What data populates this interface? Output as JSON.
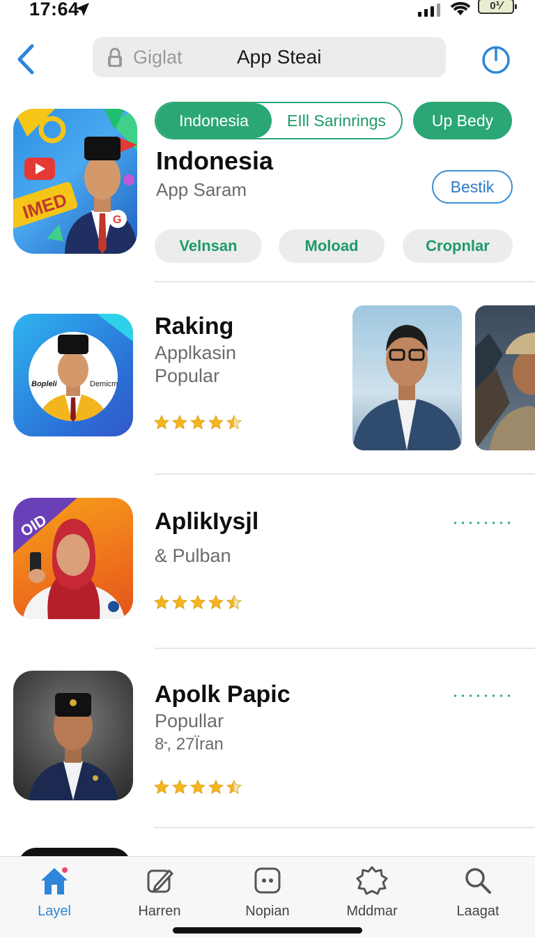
{
  "status_bar": {
    "time": "17:64",
    "battery_text": "0⅟"
  },
  "nav": {
    "search_placeholder": "Giglat",
    "title": "App Steai"
  },
  "featured": {
    "segment_left": "Indonesia",
    "segment_right": "EIll Sarinrings",
    "action_button": "Up Bedy",
    "title": "Indonesia",
    "subtitle": "App Saram",
    "secondary_button": "Bestik",
    "pills": [
      "Velnsan",
      "Moload",
      "Cropnlar"
    ],
    "icon_text": "IMED"
  },
  "rows": [
    {
      "title": "Raking",
      "subtitle_lines": [
        "Appl­kasin",
        "Popular"
      ],
      "rating": 4.5,
      "icon_texts": [
        "Bopleli",
        "Demicm"
      ]
    },
    {
      "title": "Aplik­Iysjl",
      "subtitle_lines": [
        "& Pulban"
      ],
      "rating": 4.5,
      "icon_texts": [
        "OID"
      ]
    },
    {
      "title": "Apolk Papic",
      "subtitle_lines": [
        "Popullar",
        "8᠊, 27Ïran"
      ],
      "rating": 4.5
    }
  ],
  "tabs": [
    {
      "label": "Layel",
      "icon": "house-icon",
      "active": true
    },
    {
      "label": "Harren",
      "icon": "edit-icon",
      "active": false
    },
    {
      "label": "Nopian",
      "icon": "dice-icon",
      "active": false
    },
    {
      "label": "Mddmar",
      "icon": "gear-badge-icon",
      "active": false
    },
    {
      "label": "Laagat",
      "icon": "search-icon",
      "active": false
    }
  ],
  "colors": {
    "accent_green": "#2aa774",
    "accent_blue": "#2d86d9",
    "star": "#f3b61f"
  }
}
